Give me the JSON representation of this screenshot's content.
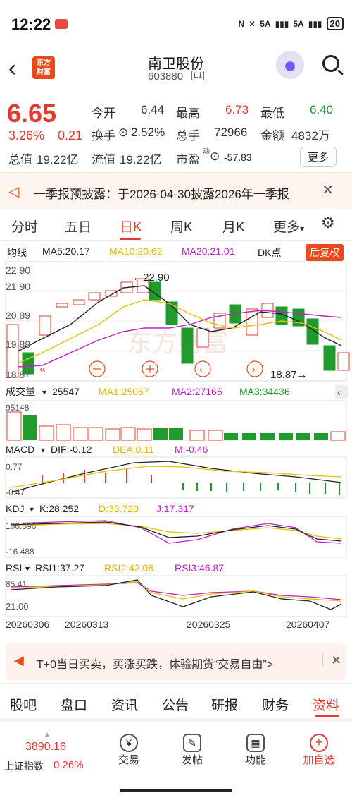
{
  "status": {
    "time": "12:22",
    "battery": "20",
    "net1": "5A",
    "net2": "5A"
  },
  "header": {
    "logo_line1": "东方",
    "logo_line2": "财富",
    "title": "南卫股份",
    "code": "603880",
    "level": "L1"
  },
  "quote": {
    "price": "6.65",
    "pct": "3.26%",
    "change": "0.21",
    "open_label": "今开",
    "open": "6.44",
    "high_label": "最高",
    "high": "6.73",
    "low_label": "最低",
    "low": "6.40",
    "turnover_label": "换手",
    "turnover": "2.52%",
    "volume_label": "总手",
    "volume": "72966",
    "amount_label": "金额",
    "amount": "4832万",
    "totalcap_label": "总值",
    "totalcap": "19.22亿",
    "floatcap_label": "流值",
    "floatcap": "19.22亿",
    "pe_label": "市盈",
    "pe_sup": "动",
    "pe": "-57.83",
    "more": "更多"
  },
  "notice": {
    "text": "一季报预披露：于2026-04-30披露2026年一季报"
  },
  "tabs": [
    "分时",
    "五日",
    "日K",
    "周K",
    "月K",
    "更多"
  ],
  "ma": {
    "label": "均线",
    "ma5": "MA5:20.17",
    "ma10": "MA10:20.62",
    "ma20": "MA20:21.01",
    "dk": "DK点",
    "adj": "后复权"
  },
  "axis": {
    "p1": "22.90",
    "p2": "21.90",
    "p3": "20.89",
    "p4": "19.88",
    "p5": "18.87",
    "hi": "22.90",
    "lo": "18.87"
  },
  "vol": {
    "label": "成交量",
    "v": "25547",
    "ma1": "MA1:25057",
    "ma2": "MA2:27165",
    "ma3": "MA3:34436",
    "top": "95148"
  },
  "macd": {
    "label": "MACD",
    "dif": "DIF:-0.12",
    "dea": "DEA:0.11",
    "m": "M:-0.46",
    "top": "0.77",
    "bot": "-0.47"
  },
  "kdj": {
    "label": "KDJ",
    "k": "K:28.252",
    "d": "D:33.720",
    "j": "J:17.317",
    "top": "106.696",
    "bot": "-16.488"
  },
  "rsi": {
    "label": "RSI",
    "r1": "RSI1:37.27",
    "r2": "RSI2:42.08",
    "r3": "RSI3:46.87",
    "top": "85.41",
    "bot": "21.00"
  },
  "dates": [
    "20260306",
    "20260313",
    "20260325",
    "20260407"
  ],
  "promo": {
    "text": "T+0当日买卖，买涨买跌，体验期货“交易自由”>"
  },
  "bottomtabs": [
    "股吧",
    "盘口",
    "资讯",
    "公告",
    "研报",
    "财务",
    "资料"
  ],
  "dock": {
    "index_value": "3890.16",
    "index_name": "上证指数",
    "index_pct": "0.26%",
    "trade": "交易",
    "post": "发帖",
    "func": "功能",
    "add": "加自选"
  },
  "colors": {
    "up": "#e23b2e",
    "down": "#1e9b2c",
    "accent": "#e23b2e"
  }
}
